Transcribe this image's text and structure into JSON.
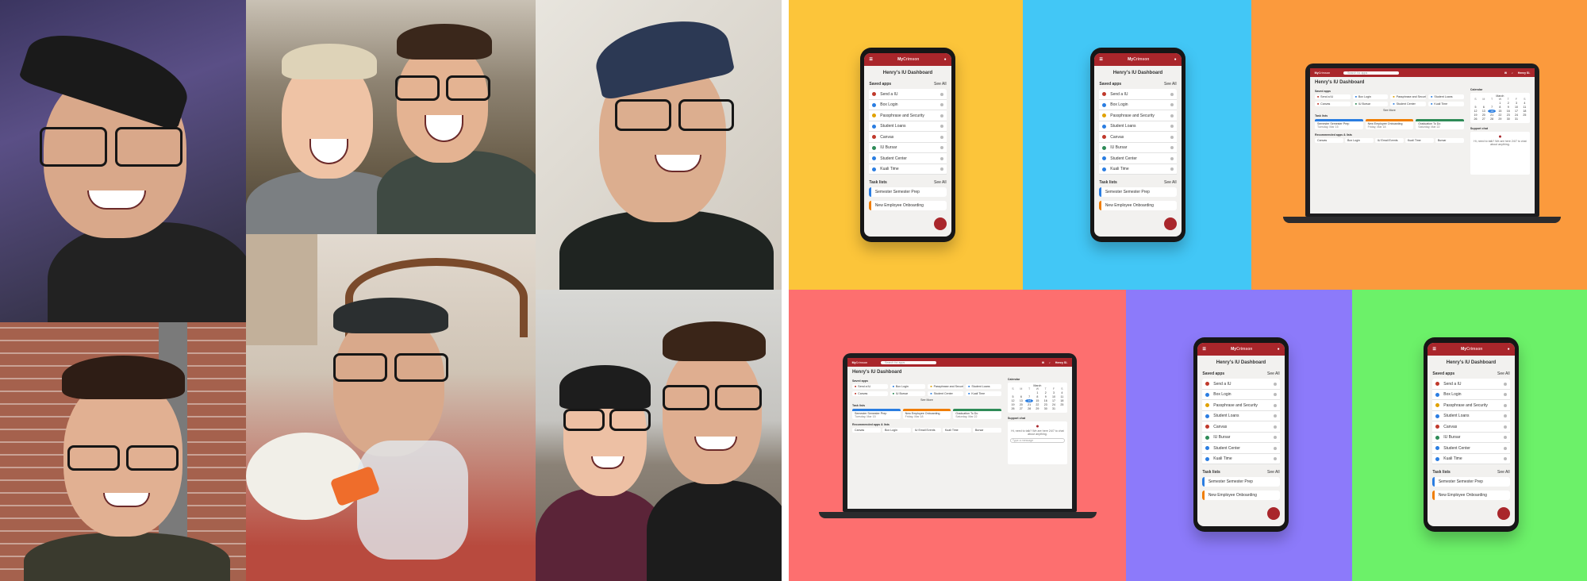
{
  "dashboard": {
    "brand_a": "My",
    "brand_b": "Crimson",
    "title": "Henry's IU Dashboard",
    "saved_apps_label": "Saved apps",
    "see_all": "See All",
    "apps": [
      {
        "label": "Send a IU",
        "color": "#c0392b"
      },
      {
        "label": "Box Login",
        "color": "#2a7de1"
      },
      {
        "label": "Passphrase and Security",
        "color": "#e0a100"
      },
      {
        "label": "Student Loans",
        "color": "#2a7de1"
      },
      {
        "label": "Canvas",
        "color": "#c0392b"
      },
      {
        "label": "IU Bursar",
        "color": "#2e8b57"
      },
      {
        "label": "Student Center",
        "color": "#2a7de1"
      },
      {
        "label": "Kuali Time",
        "color": "#2a7de1"
      }
    ],
    "task_lists_label": "Task lists",
    "tasks": [
      {
        "label": "Semester Semester Prep",
        "color": "#2a7de1"
      },
      {
        "label": "New Employee Onboarding",
        "color": "#f07d00"
      }
    ],
    "laptop": {
      "search_placeholder": "Search for apps",
      "user": "Henry Sl.",
      "calendar_label": "Calendar",
      "month": "March",
      "weekdays": [
        "S",
        "M",
        "T",
        "W",
        "T",
        "F",
        "S"
      ],
      "days": [
        "",
        "",
        "",
        "1",
        "2",
        "3",
        "4",
        "5",
        "6",
        "7",
        "8",
        "9",
        "10",
        "11",
        "12",
        "13",
        "14",
        "15",
        "16",
        "17",
        "18",
        "19",
        "20",
        "21",
        "22",
        "23",
        "24",
        "25",
        "26",
        "27",
        "28",
        "29",
        "30",
        "31",
        "",
        ""
      ],
      "today": "14",
      "see_more": "See More",
      "support_label": "Support chat",
      "support_text": "Hi, need to talk? We are here 24/7 to chat about anything.",
      "support_input": "Type a message",
      "recommended_label": "Recommended apps & lists",
      "recommended": [
        "Canvas",
        "Box Login",
        "IU Email Events",
        "Kuali Time",
        "Bursar"
      ],
      "tasks_laptop": [
        {
          "label": "Semester Semester Prep",
          "meta": "Tuesday, Mar 15",
          "color": "#2a7de1"
        },
        {
          "label": "New Employee Onboarding",
          "meta": "Friday, Mar 18",
          "color": "#f07d00"
        },
        {
          "label": "Graduation To Do",
          "meta": "Saturday, Mar 22",
          "color": "#2e8b57"
        }
      ]
    }
  },
  "colors": {
    "crimson": "#a9262b",
    "yellow_bg": "#fcc53a",
    "cyan_bg": "#42c7f6",
    "orange_bg": "#fb9a3d",
    "red_bg": "#fd6f6f",
    "purple_bg": "#8c7afa",
    "green_bg": "#6cf169"
  }
}
